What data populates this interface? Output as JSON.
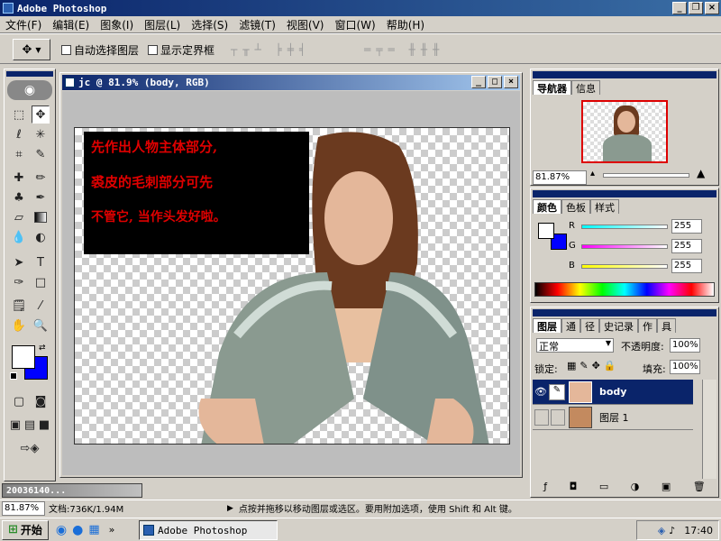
{
  "app": {
    "title": "Adobe Photoshop"
  },
  "menu": [
    "文件(F)",
    "编辑(E)",
    "图象(I)",
    "图层(L)",
    "选择(S)",
    "滤镜(T)",
    "视图(V)",
    "窗口(W)",
    "帮助(H)"
  ],
  "options": {
    "auto_select_label": "自动选择图层",
    "show_bounds_label": "显示定界框"
  },
  "document": {
    "title": "jc @ 81.9% (body, RGB)",
    "note_lines": [
      "先作出人物主体部分,",
      "裘皮的毛刺部分可先",
      "不管它, 当作头发好啦。"
    ]
  },
  "navigator": {
    "tabs": [
      "导航器",
      "信息"
    ],
    "zoom": "81.87%"
  },
  "color": {
    "tabs": [
      "颜色",
      "色板",
      "样式"
    ],
    "r_label": "R",
    "g_label": "G",
    "b_label": "B",
    "r": "255",
    "g": "255",
    "b": "255"
  },
  "layers": {
    "tabs": [
      "图层",
      "通",
      "径",
      "史记录",
      "作",
      "具"
    ],
    "blend_mode": "正常",
    "opacity_label": "不透明度:",
    "opacity": "100%",
    "lock_label": "锁定:",
    "fill_label": "填充:",
    "fill": "100%",
    "items": [
      {
        "name": "body",
        "active": true
      },
      {
        "name": "图层 1",
        "active": false
      }
    ]
  },
  "minimized": {
    "label": "20036140..."
  },
  "status": {
    "zoom": "81.87%",
    "doc": "文档:736K/1.94M",
    "hint": "点按并拖移以移动图层或选区。要用附加选项，使用 Shift 和 Alt 键。"
  },
  "taskbar": {
    "start": "开始",
    "item": "Adobe Photoshop",
    "time": "17:40"
  }
}
